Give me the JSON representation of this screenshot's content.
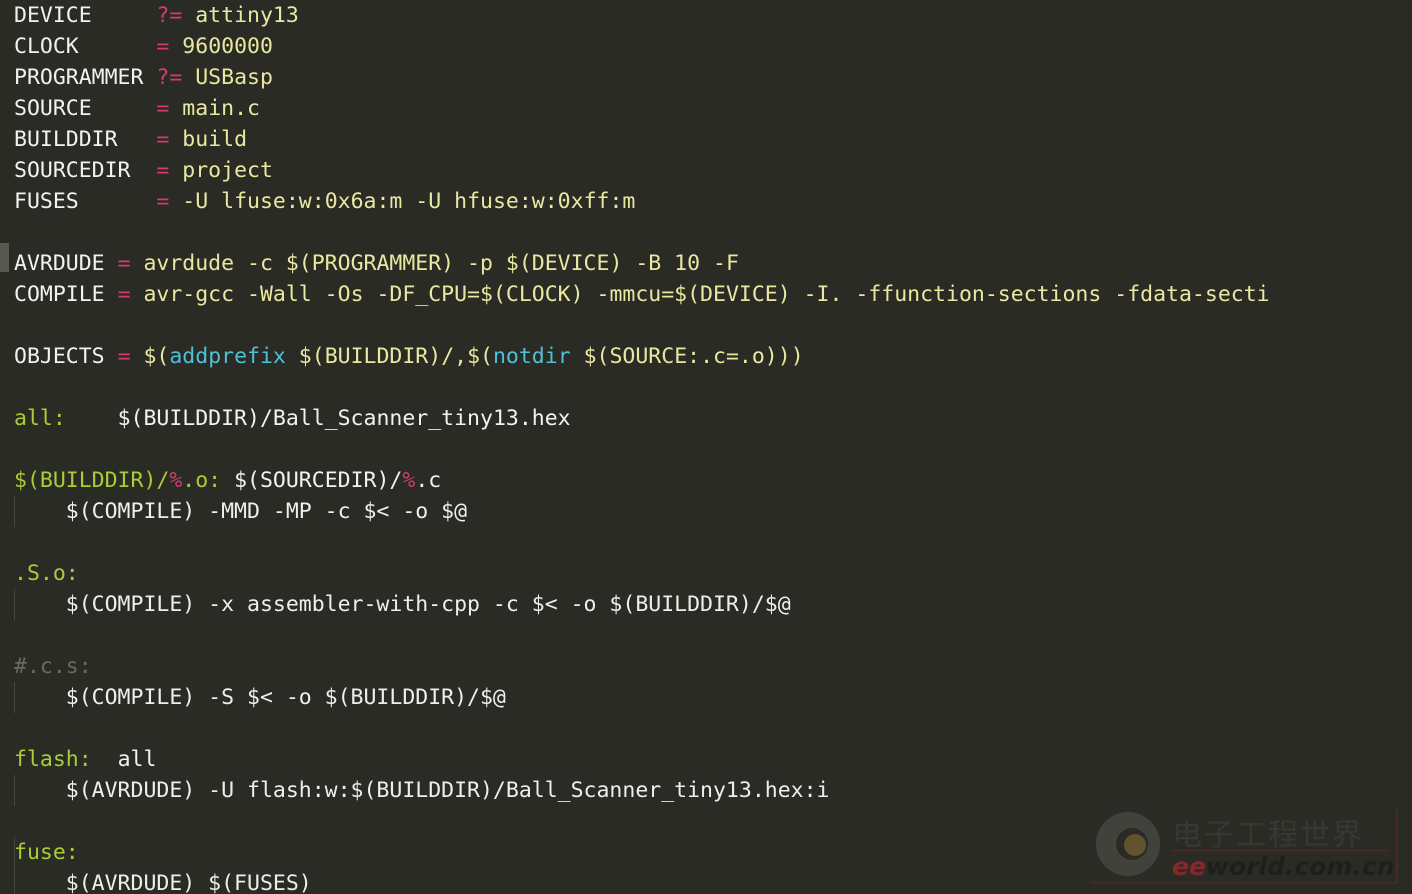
{
  "editor": {
    "filetype": "makefile",
    "background_color": "#2b2b26",
    "colors": {
      "variable": "#f2f2ee",
      "operator": "#d93a6e",
      "value": "#e8e8a0",
      "target": "#a8cd35",
      "percent": "#d93a6e",
      "function": "#4fc1d4",
      "command": "#eeeeea",
      "comment": "#6b6b62",
      "indent_guide": "#474740",
      "cursor_block": "#58584e"
    }
  },
  "lines": [
    {
      "num": 1,
      "kind": "assignment",
      "name": "DEVICE",
      "pad": "     ",
      "op": "?=",
      "value": " attiny13"
    },
    {
      "num": 2,
      "kind": "assignment",
      "name": "CLOCK",
      "pad": "      ",
      "op": "=",
      "value": " 9600000"
    },
    {
      "num": 3,
      "kind": "assignment",
      "name": "PROGRAMMER",
      "pad": " ",
      "op": "?=",
      "value": " USBasp"
    },
    {
      "num": 4,
      "kind": "assignment",
      "name": "SOURCE",
      "pad": "     ",
      "op": "=",
      "value": " main.c"
    },
    {
      "num": 5,
      "kind": "assignment",
      "name": "BUILDDIR",
      "pad": "   ",
      "op": "=",
      "value": " build"
    },
    {
      "num": 6,
      "kind": "assignment",
      "name": "SOURCEDIR",
      "pad": "  ",
      "op": "=",
      "value": " project"
    },
    {
      "num": 7,
      "kind": "assignment",
      "name": "FUSES",
      "pad": "      ",
      "op": "=",
      "value": " -U lfuse:w:0x6a:m -U hfuse:w:0xff:m"
    },
    {
      "num": 8,
      "kind": "blank"
    },
    {
      "num": 9,
      "kind": "assignment",
      "name": "AVRDUDE",
      "pad": " ",
      "op": "=",
      "value": " avrdude -c $(PROGRAMMER) -p $(DEVICE) -B 10 -F"
    },
    {
      "num": 10,
      "kind": "assignment",
      "name": "COMPILE",
      "pad": " ",
      "op": "=",
      "value": " avr-gcc -Wall -Os -DF_CPU=$(CLOCK) -mmcu=$(DEVICE) -I. -ffunction-sections -fdata-secti"
    },
    {
      "num": 11,
      "kind": "blank"
    },
    {
      "num": 12,
      "kind": "objects",
      "name": "OBJECTS",
      "pad": " ",
      "op": "=",
      "parts": [
        {
          "t": "val",
          "s": " $("
        },
        {
          "t": "fn",
          "s": "addprefix"
        },
        {
          "t": "val",
          "s": " $(BUILDDIR)/,$("
        },
        {
          "t": "fn",
          "s": "notdir"
        },
        {
          "t": "val",
          "s": " $(SOURCE:.c=.o)))"
        }
      ]
    },
    {
      "num": 13,
      "kind": "blank"
    },
    {
      "num": 14,
      "kind": "rule",
      "target": "all:",
      "gap": "    ",
      "prereq": "$(BUILDDIR)/Ball_Scanner_tiny13.hex"
    },
    {
      "num": 15,
      "kind": "blank"
    },
    {
      "num": 16,
      "kind": "pattern-rule",
      "parts": [
        {
          "t": "tgt",
          "s": "$(BUILDDIR)/"
        },
        {
          "t": "pct",
          "s": "%"
        },
        {
          "t": "tgt",
          "s": ".o:"
        },
        {
          "t": "plain",
          "s": " $(SOURCEDIR)/"
        },
        {
          "t": "pct",
          "s": "%"
        },
        {
          "t": "plain",
          "s": ".c"
        }
      ]
    },
    {
      "num": 17,
      "kind": "command",
      "text": "    $(COMPILE) -MMD -MP -c $< -o $@"
    },
    {
      "num": 18,
      "kind": "blank"
    },
    {
      "num": 19,
      "kind": "rule",
      "target": ".S.o:",
      "gap": "",
      "prereq": ""
    },
    {
      "num": 20,
      "kind": "command",
      "text": "    $(COMPILE) -x assembler-with-cpp -c $< -o $(BUILDDIR)/$@"
    },
    {
      "num": 21,
      "kind": "blank"
    },
    {
      "num": 22,
      "kind": "comment",
      "text": "#.c.s:"
    },
    {
      "num": 23,
      "kind": "command",
      "text": "    $(COMPILE) -S $< -o $(BUILDDIR)/$@"
    },
    {
      "num": 24,
      "kind": "blank"
    },
    {
      "num": 25,
      "kind": "rule",
      "target": "flash:",
      "gap": "  ",
      "prereq": "all"
    },
    {
      "num": 26,
      "kind": "command",
      "text": "    $(AVRDUDE) -U flash:w:$(BUILDDIR)/Ball_Scanner_tiny13.hex:i"
    },
    {
      "num": 27,
      "kind": "blank"
    },
    {
      "num": 28,
      "kind": "rule",
      "target": "fuse:",
      "gap": "",
      "prereq": ""
    },
    {
      "num": 29,
      "kind": "command",
      "text": "    $(AVRDUDE) $(FUSES)"
    }
  ],
  "watermark": {
    "cn_text": "电子工程世界",
    "url_prefix": "ee",
    "url_rest": "world.com.cn",
    "logo_icon": "eeworld-logo-icon"
  }
}
